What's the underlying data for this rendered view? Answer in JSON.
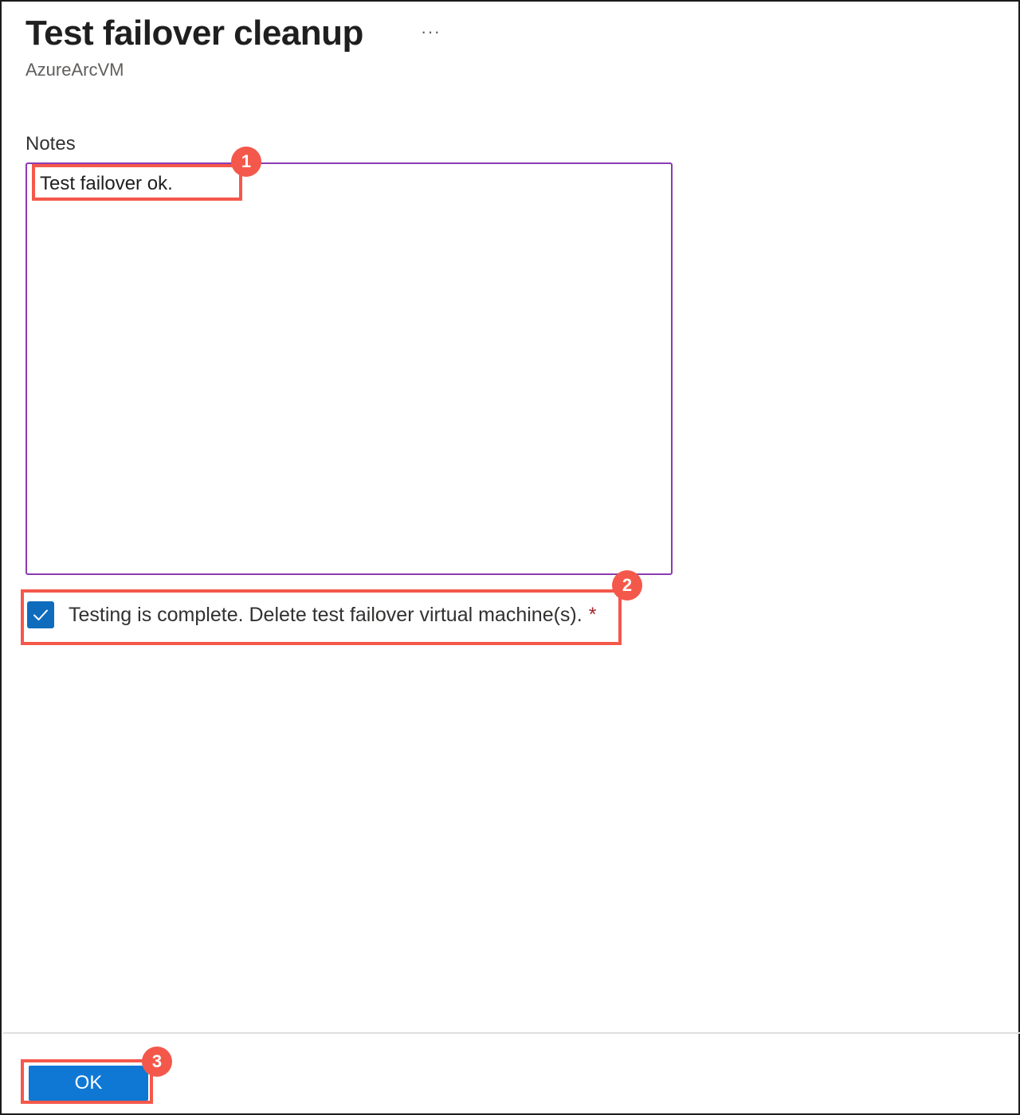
{
  "header": {
    "title": "Test failover cleanup",
    "more_label": "···",
    "subtitle": "AzureArcVM"
  },
  "form": {
    "notes_label": "Notes",
    "notes_value": "Test failover ok.",
    "checkbox_label": "Testing is complete. Delete test failover virtual machine(s).",
    "checkbox_checked": true,
    "required_marker": "*"
  },
  "footer": {
    "ok_label": "OK"
  },
  "annotations": [
    {
      "number": "1"
    },
    {
      "number": "2"
    },
    {
      "number": "3"
    }
  ],
  "colors": {
    "accent": "#0f78d4",
    "textarea_border": "#8c3bb0",
    "annotation": "#f4584b"
  }
}
